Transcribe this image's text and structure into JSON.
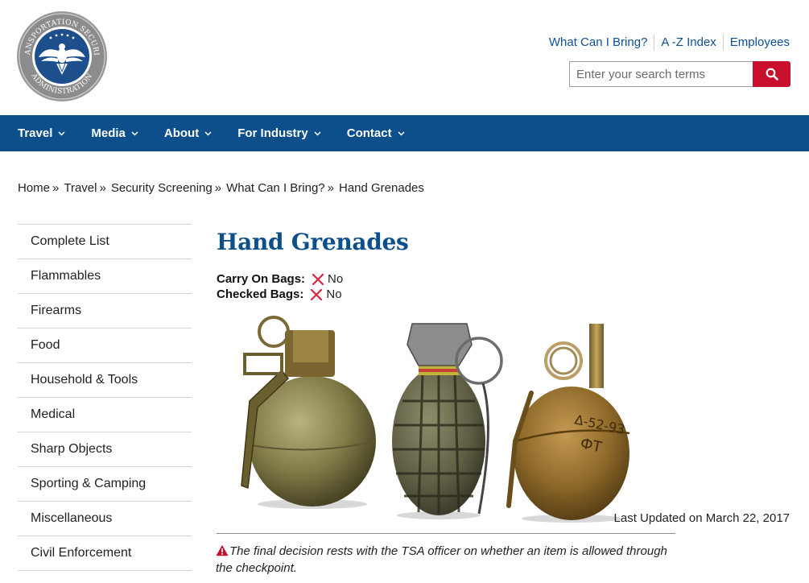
{
  "header": {
    "utility_links": [
      "What Can I Bring?",
      "A -Z Index",
      "Employees"
    ],
    "logo_text_top": "TRANSPORTATION SECURITY",
    "logo_text_bottom": "ADMINISTRATION",
    "search": {
      "placeholder": "Enter your search terms",
      "value": ""
    }
  },
  "nav": {
    "items": [
      "Travel",
      "Media",
      "About",
      "For Industry",
      "Contact"
    ]
  },
  "breadcrumb": [
    "Home",
    "Travel",
    "Security Screening",
    "What Can I Bring?",
    "Hand Grenades"
  ],
  "breadcrumb_separator": "»",
  "sidebar": {
    "items": [
      "Complete List",
      "Flammables",
      "Firearms",
      "Food",
      "Household & Tools",
      "Medical",
      "Sharp Objects",
      "Sporting & Camping",
      "Miscellaneous",
      "Civil Enforcement"
    ]
  },
  "main": {
    "title": "Hand Grenades",
    "carry_on": {
      "label": "Carry On Bags:",
      "value": "No"
    },
    "checked": {
      "label": "Checked Bags:",
      "value": "No"
    },
    "last_updated": "Last Updated on March 22, 2017",
    "disclaimer": "The final decision rests with the TSA officer on whether an item is allowed through the checkpoint.",
    "grenade_markings": [
      "Δ-52-93",
      "ФТ"
    ]
  },
  "colors": {
    "brand_blue": "#0c4f8b",
    "link_blue": "#0d5092",
    "search_red": "#c8102e",
    "deny_red": "#d7263d"
  }
}
